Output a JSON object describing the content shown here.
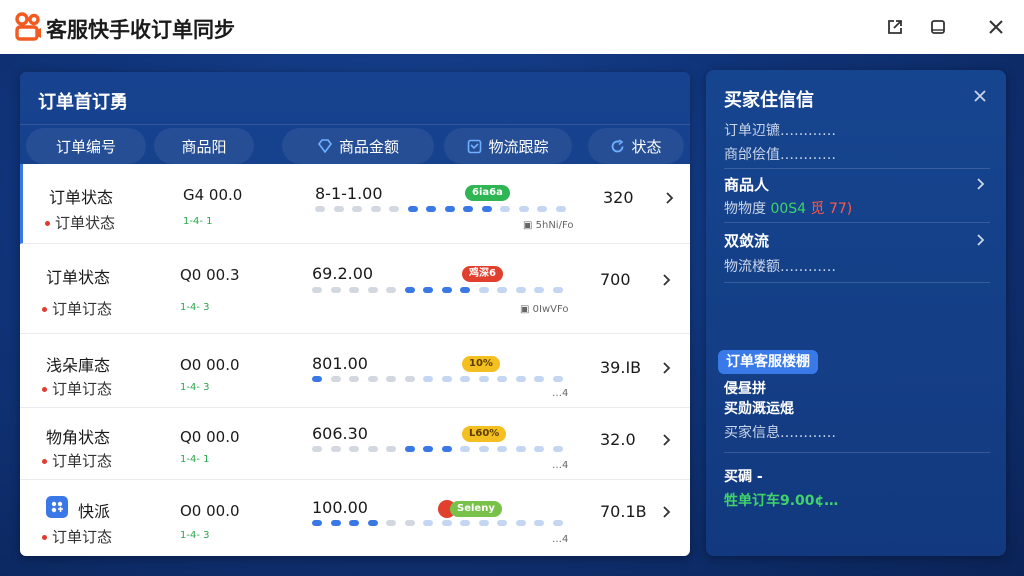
{
  "app": {
    "title": "客服快手收订单同步",
    "brand_color": "#f35a22"
  },
  "orders": {
    "title": "订单首订勇",
    "columns": [
      "订单编号",
      "商品阳",
      "商品金额",
      "物流跟踪",
      "状态"
    ],
    "rows": [
      {
        "title": "订单状态",
        "sub": "订单状态",
        "code": "G4 00.0",
        "tag": "1-4- 1",
        "amount": "8-1-1.00",
        "badge": "6ia6a",
        "badge_color": "#2fb553",
        "note": "▣ 5hNi/Fo",
        "num": "320",
        "progress": 0.78
      },
      {
        "title": "订单状态",
        "sub": "订单订态",
        "code": "Q0 00.3",
        "tag": "1-4- 3",
        "amount": "69.2.00",
        "badge": "鸡深6",
        "badge_color": "#e2402f",
        "note": "▣ 0IwVFo",
        "num": "700",
        "progress": 0.7
      },
      {
        "title": "浅朵庫态",
        "sub": "订单订态",
        "code": "O0 00.0",
        "tag": "1-4- 3",
        "amount": "801.00",
        "badge": "10%",
        "badge_color": "#f4c021",
        "note": "…4",
        "num": "39.IB",
        "progress": 0.1
      },
      {
        "title": "物角状态",
        "sub": "订单订态",
        "code": "Q0 00.0",
        "tag": "1-4- 1",
        "amount": "606.30",
        "badge": "L60%",
        "badge_color": "#f4c021",
        "note": "…4",
        "num": "32.0",
        "progress": 0.6
      },
      {
        "title": "快派",
        "sub": "订单订态",
        "code": "O0 00.0",
        "tag": "1-4- 3",
        "amount": "100.00",
        "badge": "Seleny",
        "badge_color": "#78c24a",
        "note": "…4",
        "num": "70.1B",
        "progress": 0.3
      }
    ]
  },
  "info": {
    "title": "买家住信信",
    "lines_top": [
      "订单辺镳…………",
      "商邰侩值…………"
    ],
    "goods_label": "商品人",
    "goods_value_prefix": "物物度",
    "goods_value_green": "00S4",
    "goods_value_red": "觅 77)",
    "logistics_label": "双敛流",
    "logistics_value": "物流楼额…………",
    "chip_label": "订单客服楼棚",
    "list": [
      "侵昼拼",
      "买勋溉运焜",
      "买家信息…………"
    ],
    "buy_label": "买碉 -",
    "buy_value": "牲单订车9.00¢…"
  }
}
